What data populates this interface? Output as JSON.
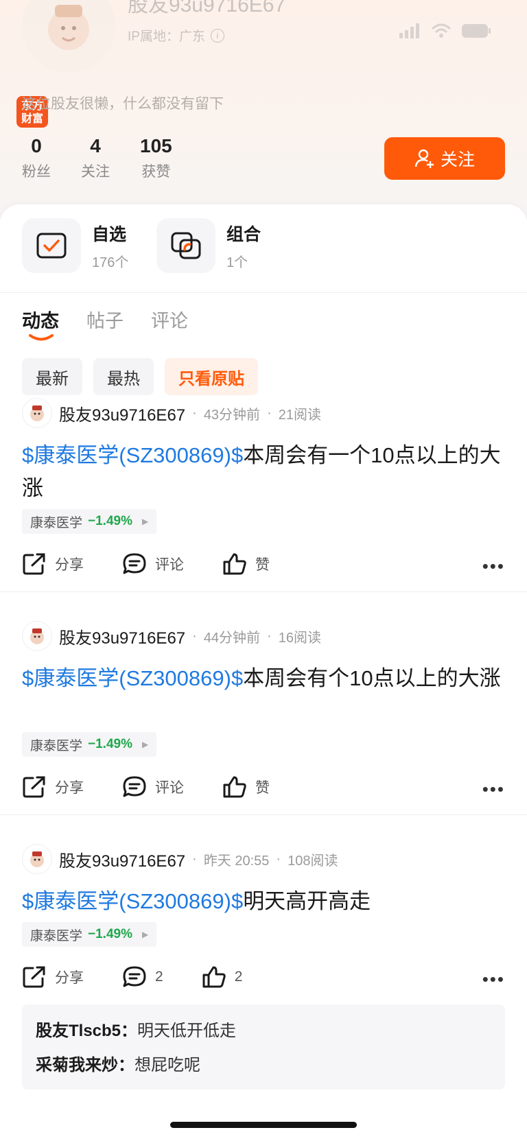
{
  "profile": {
    "username": "股友93u9716E67",
    "ip_location": "IP属地：广东",
    "bio": "这位股友很懒，什么都没有留下",
    "brand_badge": "东方财富",
    "follow_button": "关注",
    "stats": [
      {
        "value": "0",
        "label": "粉丝"
      },
      {
        "value": "4",
        "label": "关注"
      },
      {
        "value": "105",
        "label": "获赞"
      }
    ]
  },
  "shortcuts": [
    {
      "title": "自选",
      "count": "176个",
      "icon": "watchlist-check-icon"
    },
    {
      "title": "组合",
      "count": "1个",
      "icon": "portfolio-icon"
    }
  ],
  "tabs": [
    {
      "label": "动态",
      "active": true
    },
    {
      "label": "帖子",
      "active": false
    },
    {
      "label": "评论",
      "active": false
    }
  ],
  "filters": [
    {
      "label": "最新",
      "active": false
    },
    {
      "label": "最热",
      "active": false
    },
    {
      "label": "只看原贴",
      "active": true
    }
  ],
  "posts": [
    {
      "user": "股友93u9716E67",
      "time": "43分钟前",
      "reads": "21阅读",
      "stock_tag": "$康泰医学(SZ300869)$",
      "text": "本周会有一个10点以上的大涨",
      "chip_name": "康泰医学",
      "chip_pct": "−1.49%",
      "share": "分享",
      "comment": "评论",
      "like": "赞"
    },
    {
      "user": "股友93u9716E67",
      "time": "44分钟前",
      "reads": "16阅读",
      "stock_tag": "$康泰医学(SZ300869)$",
      "text": "本周会有个10点以上的大涨",
      "chip_name": "康泰医学",
      "chip_pct": "−1.49%",
      "share": "分享",
      "comment": "评论",
      "like": "赞"
    },
    {
      "user": "股友93u9716E67",
      "time": "昨天 20:55",
      "reads": "108阅读",
      "stock_tag": "$康泰医学(SZ300869)$",
      "text": "明天高开高走",
      "chip_name": "康泰医学",
      "chip_pct": "−1.49%",
      "share": "分享",
      "comment": "2",
      "like": "2",
      "comments": [
        {
          "user": "股友Tlscb5：",
          "text": "明天低开低走"
        },
        {
          "user": "采菊我来炒：",
          "text": "想屁吃呢"
        }
      ]
    }
  ],
  "colors": {
    "accent": "#ff5a0a",
    "stock_link": "#1f7ae0",
    "down": "#1fa74a"
  }
}
